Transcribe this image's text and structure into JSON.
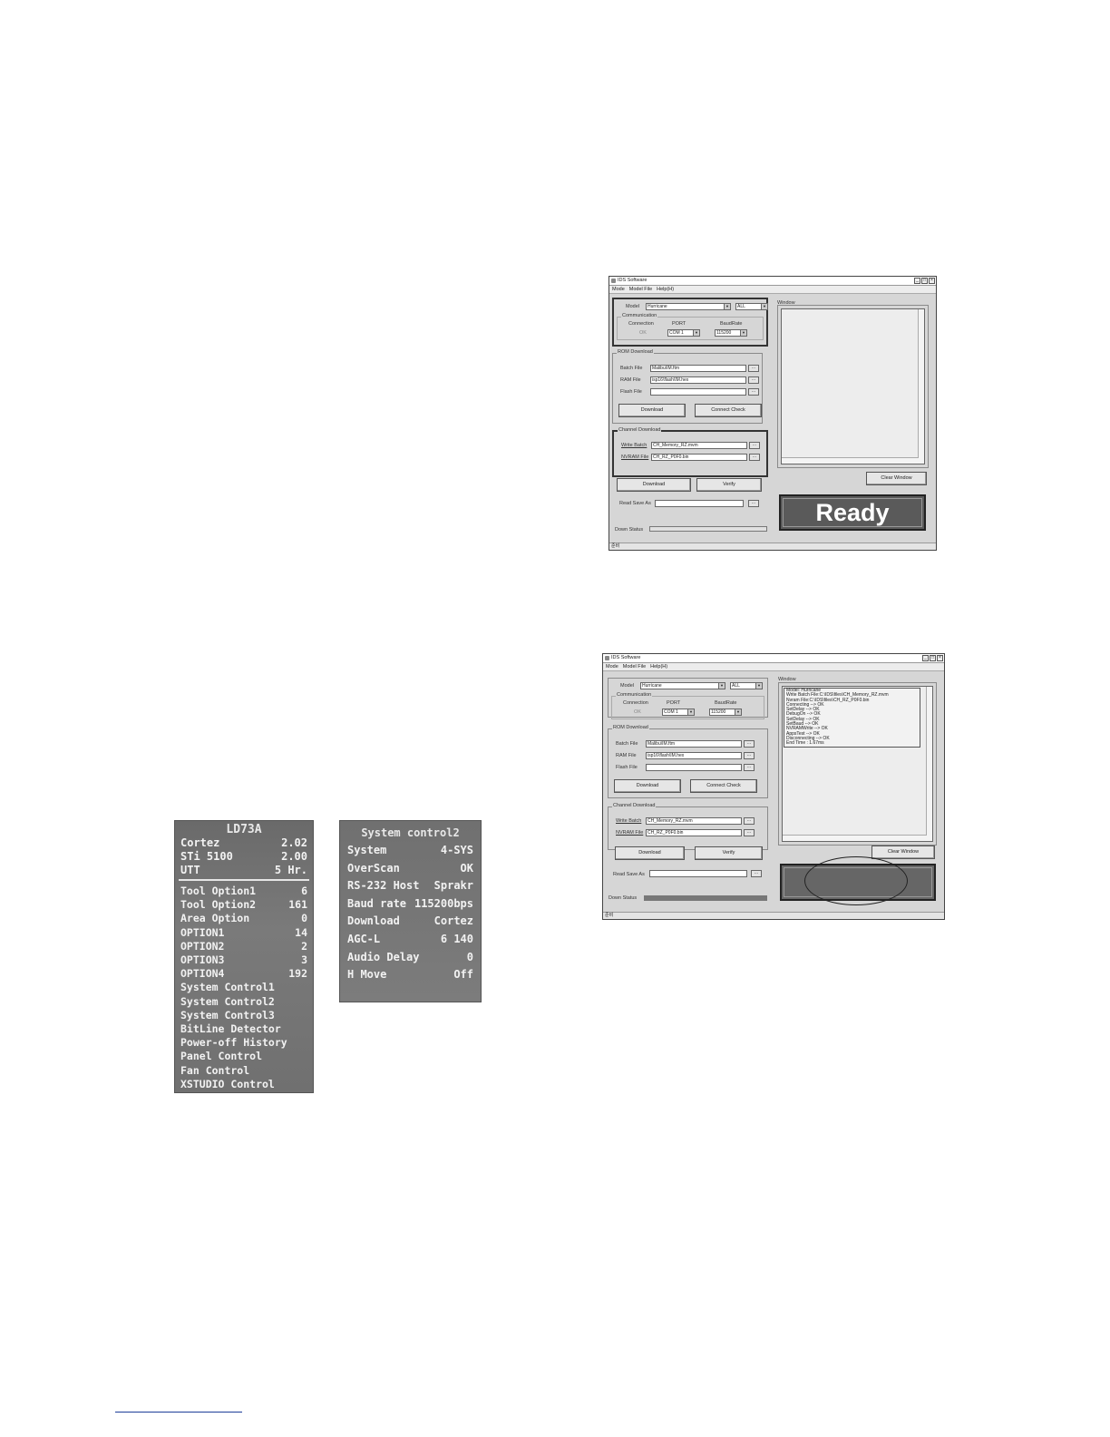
{
  "windows": [
    {
      "title": "IDS Software",
      "menu": [
        "Mode",
        "Model File",
        "Help(H)"
      ],
      "model_label": "Model",
      "model_value": "Hurricane",
      "all_value": "ALL",
      "communication_title": "Communication",
      "connection_label": "Connection",
      "port_label": "PORT",
      "baud_label": "BaudRate",
      "connection_status": "OK",
      "port_value": "COM 1",
      "baud_value": "115200",
      "rom_title": "ROM Download",
      "batch_label": "Batch File",
      "batch_value": "Malibu\\IM.ftm",
      "ram_label": "RAM File",
      "ram_value": "isp16\\flash\\IM.hex",
      "flash_label": "Flash File",
      "flash_value": "",
      "download_label": "Download",
      "connect_check_label": "Connect Check",
      "channel_title": "Channel Download",
      "write_batch_label": "Write Batch",
      "write_batch_value": "CH_Memory_RZ.mvm",
      "nvram_label": "NVRAM File",
      "nvram_value": "CH_RZ_P0F0.bin",
      "verify_label": "Verify",
      "read_save_label": "Read Save As",
      "read_save_value": "",
      "down_status_label": "Down Status",
      "down_status_progress": 0,
      "window_title": "Window",
      "clear_window_label": "Clear Window",
      "status_text": "Ready",
      "statusbar_text": "준비",
      "log_lines": []
    },
    {
      "title": "IDS Software",
      "menu": [
        "Mode",
        "Model File",
        "Help(H)"
      ],
      "model_label": "Model",
      "model_value": "Hurricane",
      "all_value": "ALL",
      "communication_title": "Communication",
      "connection_label": "Connection",
      "port_label": "PORT",
      "baud_label": "BaudRate",
      "connection_status": "OK",
      "port_value": "COM 1",
      "baud_value": "115200",
      "rom_title": "ROM Download",
      "batch_label": "Batch File",
      "batch_value": "Malibu\\IM.ftm",
      "ram_label": "RAM File",
      "ram_value": "isp16\\flash\\IM.hex",
      "flash_label": "Flash File",
      "flash_value": "",
      "download_label": "Download",
      "connect_check_label": "Connect Check",
      "channel_title": "Channel Download",
      "write_batch_label": "Write Batch",
      "write_batch_value": "CH_Memory_RZ.mvm",
      "nvram_label": "NVRAM File",
      "nvram_value": "CH_RZ_P0F0.bin",
      "verify_label": "Verify",
      "read_save_label": "Read Save As",
      "read_save_value": "",
      "down_status_label": "Down Status",
      "down_status_progress": 1.0,
      "window_title": "Window",
      "clear_window_label": "Clear Window",
      "status_text": "",
      "statusbar_text": "준비",
      "log_lines": [
        "Model: Hurricane",
        "Write Batch File:C:\\IDS\\files\\CH_Memory_RZ.mvm",
        "Nvram File:C:\\IDS\\files\\CH_RZ_P0F0.bin",
        "Connecting --> OK",
        "SetDelay --> OK",
        "DebugOn --> OK",
        "SetDelay --> OK",
        "SetBaud --> OK",
        "NVRAMWrite --> OK",
        "AppsTest --> OK",
        "Disconnecting --> OK",
        "End Time : 1.67ms"
      ]
    }
  ],
  "photo_main": {
    "title": "LD73A",
    "version_rows": [
      {
        "label": "Cortez",
        "value": "2.02"
      },
      {
        "label": "STi 5100",
        "value": "2.00"
      },
      {
        "label": "UTT",
        "value": "5  Hr."
      }
    ],
    "menu_rows": [
      {
        "label": "Tool Option1",
        "value": "6"
      },
      {
        "label": "Tool Option2",
        "value": "161"
      },
      {
        "label": "Area Option",
        "value": "0"
      },
      {
        "label": "OPTION1",
        "value": "14"
      },
      {
        "label": "OPTION2",
        "value": "2"
      },
      {
        "label": "OPTION3",
        "value": "3"
      },
      {
        "label": "OPTION4",
        "value": "192"
      },
      {
        "label": "System Control1",
        "value": ""
      },
      {
        "label": "System Control2",
        "value": ""
      },
      {
        "label": "System Control3",
        "value": ""
      },
      {
        "label": "BitLine Detector",
        "value": ""
      },
      {
        "label": "Power-off History",
        "value": ""
      },
      {
        "label": "Panel Control",
        "value": ""
      },
      {
        "label": "Fan Control",
        "value": ""
      },
      {
        "label": "XSTUDIO Control",
        "value": ""
      }
    ]
  },
  "photo_system": {
    "title": "System control2",
    "rows": [
      {
        "label": "System",
        "value": "4-SYS"
      },
      {
        "label": "OverScan",
        "value": "OK"
      },
      {
        "label": "RS-232 Host",
        "value": "Sprakr"
      },
      {
        "label": "Baud rate",
        "value": "115200bps"
      },
      {
        "label": "Download",
        "value": "Cortez"
      },
      {
        "label": "AGC-L",
        "value": "6   140"
      },
      {
        "label": "Audio Delay",
        "value": "0"
      },
      {
        "label": "H Move",
        "value": "Off"
      }
    ]
  }
}
